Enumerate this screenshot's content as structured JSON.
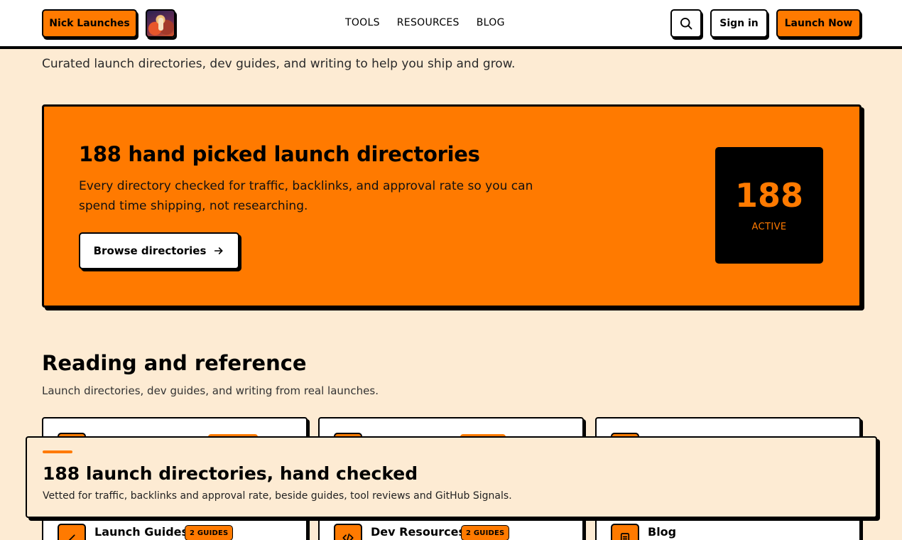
{
  "header": {
    "brand_label": "Nick Launches",
    "nav": [
      "TOOLS",
      "RESOURCES",
      "BLOG"
    ],
    "signin_label": "Sign in",
    "launch_label": "Launch Now"
  },
  "tagline": "Curated launch directories, dev guides, and writing to help you ship and grow.",
  "hero": {
    "title": "188 hand picked launch directories",
    "description": "Every directory checked for traffic, backlinks, and approval rate so you can spend time shipping, not researching.",
    "button_label": "Browse directories",
    "stat_value": "188",
    "stat_label": "ACTIVE"
  },
  "section": {
    "title": "Reading and reference",
    "subtitle": "Launch directories, dev guides, and writing from real launches."
  },
  "cards": [
    {
      "name": "Launch Guides",
      "badge": "2 GUIDES",
      "icon": "pencil-icon"
    },
    {
      "name": "Dev Resources",
      "badge": "2 GUIDES",
      "icon": "code-icon"
    },
    {
      "name": "Blog",
      "badge": "",
      "icon": "document-icon"
    }
  ],
  "banner": {
    "title": "188 launch directories, hand checked",
    "subtitle": "Vetted for traffic, backlinks and approval rate, beside guides, tool reviews and GitHub Signals."
  },
  "colors": {
    "accent": "#ff7a00",
    "background": "#fdebd3",
    "ink": "#000000"
  }
}
